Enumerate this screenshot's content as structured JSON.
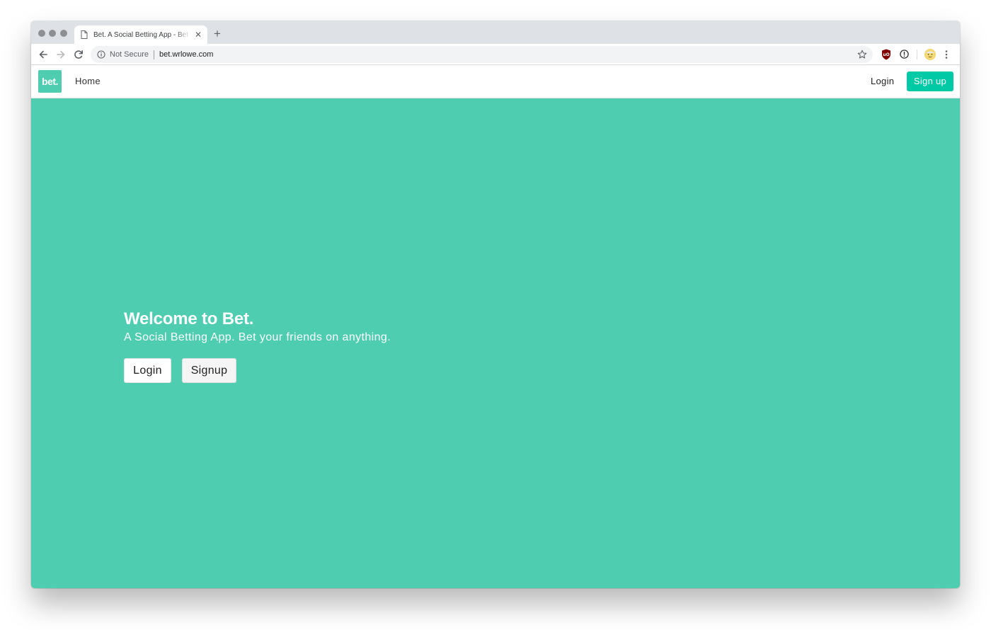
{
  "browser": {
    "tab": {
      "title": "Bet. A Social Betting App - Bet"
    },
    "omnibox": {
      "security_label": "Not Secure",
      "url": "bet.wrlowe.com"
    }
  },
  "site": {
    "brand": "bet.",
    "nav": {
      "home_label": "Home",
      "login_label": "Login",
      "signup_label": "Sign up"
    },
    "hero": {
      "title": "Welcome to Bet.",
      "subtitle": "A Social Betting App. Bet your friends on anything.",
      "login_button": "Login",
      "signup_button": "Signup"
    }
  },
  "colors": {
    "brand_teal": "#4ecdb1",
    "signup_accent": "#00c9a6",
    "chrome_tabstrip": "#dee1e6"
  },
  "icons": [
    "document-icon",
    "close-icon",
    "new-tab-icon",
    "back-icon",
    "forward-icon",
    "reload-icon",
    "info-icon",
    "star-icon",
    "ublock-icon",
    "extension-info-icon",
    "avatar",
    "menu-icon"
  ]
}
